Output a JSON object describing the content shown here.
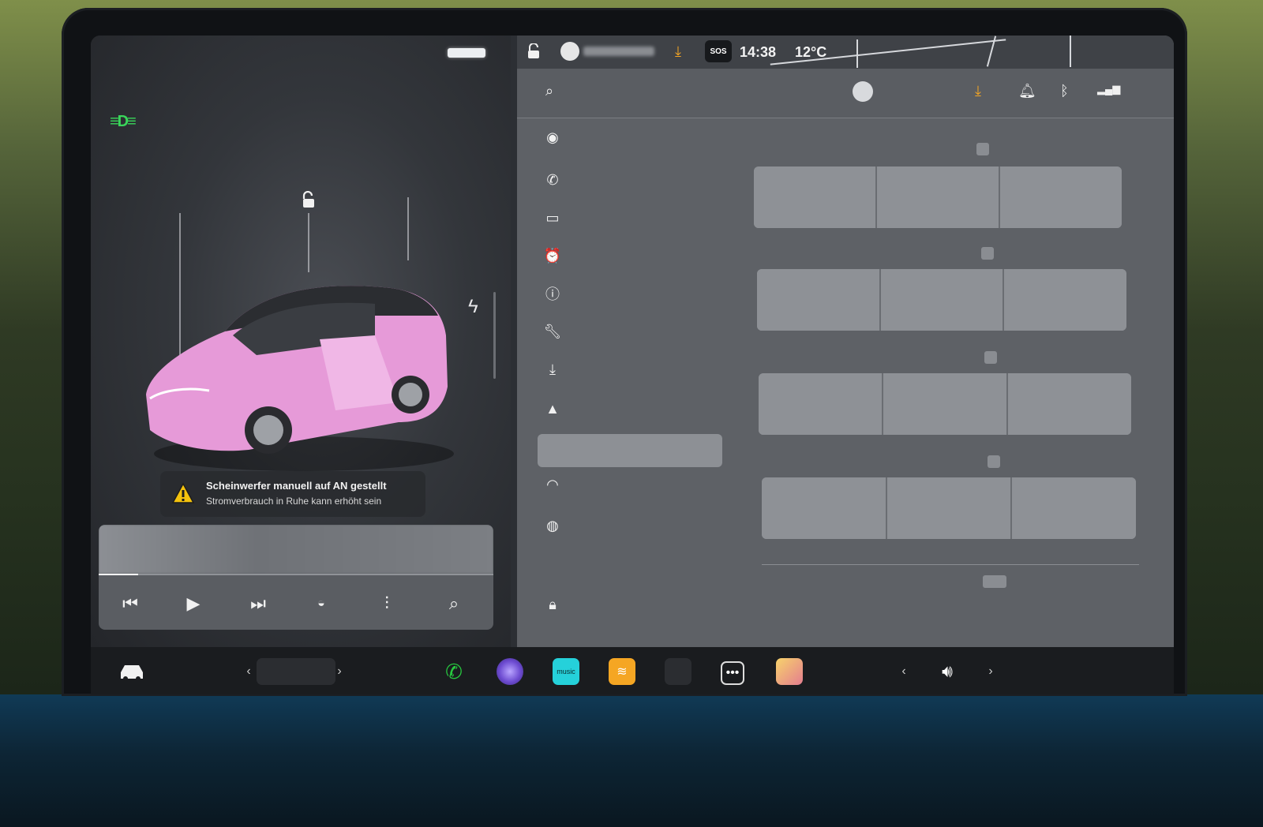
{
  "status_bar": {
    "time": "14:38",
    "temperature": "12°C",
    "sos_label": "SOS"
  },
  "alert": {
    "line1": "Scheinwerfer manuell auf AN gestellt",
    "line2": "Stromverbrauch in Ruhe kann erhöht sein"
  },
  "icons": {
    "headlights": "headlights-on-icon",
    "lock": "unlocked-icon",
    "charge": "charge-port-icon",
    "warning": "warning-icon"
  },
  "media": {
    "progress": 0.1,
    "controls": [
      "previous-track-icon",
      "play-icon",
      "next-track-icon",
      "source-icon",
      "equalizer-icon",
      "search-icon"
    ]
  },
  "settings_nav": [
    "controls-icon",
    "phone-icon",
    "display-icon",
    "schedule-icon",
    "safety-icon",
    "service-icon",
    "software-icon",
    "navigation-icon",
    "selected-item",
    "wifi-icon",
    "other-icon",
    "lock-icon"
  ],
  "taskbar": {
    "volume": "volume-icon",
    "apps": [
      "car-icon",
      "phone-app-icon",
      "camera-app-icon",
      "amazon-music-icon",
      "audible-icon",
      "more-apps-icon",
      "toybox-icon"
    ],
    "music_label": "music"
  },
  "colors": {
    "headlight_green": "#39d65a",
    "download_orange": "#f5a623",
    "warning_yellow": "#f4c20d",
    "car_pink": "#e69ad8",
    "phone_green": "#27c93f"
  }
}
